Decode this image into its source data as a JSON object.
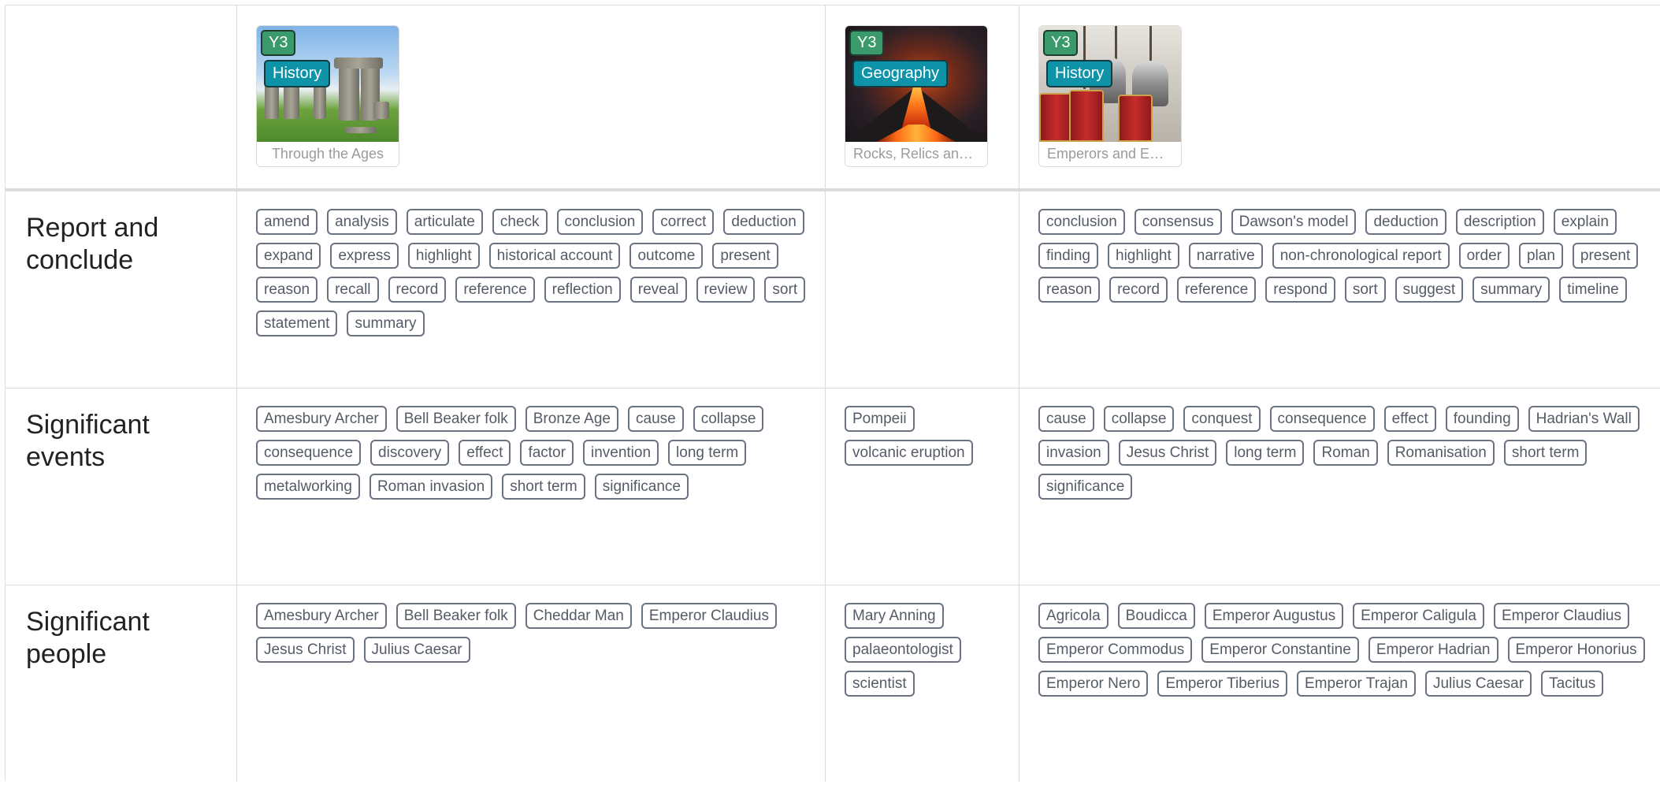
{
  "topics": [
    {
      "year": "Y3",
      "subject": "History",
      "caption": "Through the Ages",
      "image": "stonehenge-image"
    },
    {
      "year": "Y3",
      "subject": "Geography",
      "caption": "Rocks, Relics and ...",
      "image": "volcano-image"
    },
    {
      "year": "Y3",
      "subject": "History",
      "caption": "Emperors and Em...",
      "image": "roman-soldiers-image"
    }
  ],
  "rows": [
    {
      "label": "Report and\nconclude",
      "cells": [
        [
          "amend",
          "analysis",
          "articulate",
          "check",
          "conclusion",
          "correct",
          "deduction",
          "expand",
          "express",
          "highlight",
          "historical account",
          "outcome",
          "present",
          "reason",
          "recall",
          "record",
          "reference",
          "reflection",
          "reveal",
          "review",
          "sort",
          "statement",
          "summary"
        ],
        [],
        [
          "conclusion",
          "consensus",
          "Dawson's model",
          "deduction",
          "description",
          "explain",
          "finding",
          "highlight",
          "narrative",
          "non-chronological report",
          "order",
          "plan",
          "present",
          "reason",
          "record",
          "reference",
          "respond",
          "sort",
          "suggest",
          "summary",
          "timeline"
        ]
      ]
    },
    {
      "label": "Significant\nevents",
      "cells": [
        [
          "Amesbury Archer",
          "Bell Beaker folk",
          "Bronze Age",
          "cause",
          "collapse",
          "consequence",
          "discovery",
          "effect",
          "factor",
          "invention",
          "long term",
          "metalworking",
          "Roman invasion",
          "short term",
          "significance"
        ],
        [
          "Pompeii",
          "volcanic eruption"
        ],
        [
          "cause",
          "collapse",
          "conquest",
          "consequence",
          "effect",
          "founding",
          "Hadrian's Wall",
          "invasion",
          "Jesus Christ",
          "long term",
          "Roman",
          "Romanisation",
          "short term",
          "significance"
        ]
      ]
    },
    {
      "label": "Significant\npeople",
      "cells": [
        [
          "Amesbury Archer",
          "Bell Beaker folk",
          "Cheddar Man",
          "Emperor Claudius",
          "Jesus Christ",
          "Julius Caesar"
        ],
        [
          "Mary Anning",
          "palaeontologist",
          "scientist"
        ],
        [
          "Agricola",
          "Boudicca",
          "Emperor Augustus",
          "Emperor Caligula",
          "Emperor Claudius",
          "Emperor Commodus",
          "Emperor Constantine",
          "Emperor Hadrian",
          "Emperor Honorius",
          "Emperor Nero",
          "Emperor Tiberius",
          "Emperor Trajan",
          "Julius Caesar",
          "Tacitus"
        ]
      ]
    }
  ]
}
